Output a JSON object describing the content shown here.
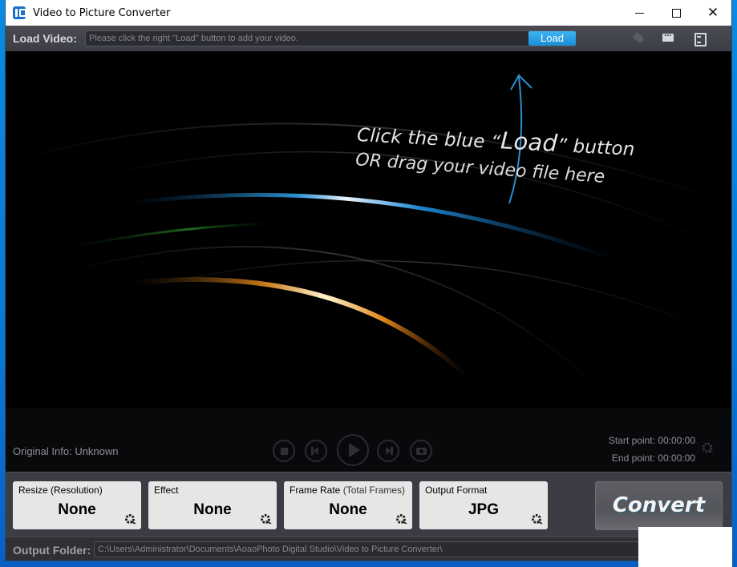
{
  "window": {
    "title": "Video to Picture Converter",
    "controls": {
      "minimize": "minimize",
      "maximize": "maximize",
      "close": "close"
    }
  },
  "toolbar": {
    "load_label": "Load Video:",
    "load_placeholder": "Please click the right ''Load'' button to add your video.",
    "load_button": "Load",
    "icons": [
      "tag-icon",
      "chat-icon",
      "report-icon"
    ]
  },
  "video": {
    "hint_line1_pre": "Click the blue “",
    "hint_line1_big": "Load",
    "hint_line1_post": "” button",
    "hint_line2": "OR drag your video file here"
  },
  "controls": {
    "original_info": "Original Info: Unknown",
    "start_point": "Start point: 00:00:00",
    "end_point": "End point: 00:00:00",
    "buttons": [
      "stop",
      "previous",
      "play",
      "next",
      "snapshot"
    ]
  },
  "settings": {
    "resize": {
      "label": "Resize (Resolution)",
      "value": "None"
    },
    "effect": {
      "label": "Effect",
      "value": "None"
    },
    "frame_rate": {
      "label": "Frame Rate",
      "label_sub": "(Total Frames)",
      "value": "None"
    },
    "output_format": {
      "label": "Output Format",
      "value": "JPG"
    },
    "convert_button": "Convert"
  },
  "output": {
    "label": "Output Folder:",
    "path": "C:\\Users\\Administrator\\Documents\\AoaoPhoto Digital Studio\\Video to Picture Converter\\"
  },
  "colors": {
    "accent_blue": "#1a8ed6",
    "desktop_blue": "#0a8be0",
    "panel_dark": "#3a3b42"
  }
}
